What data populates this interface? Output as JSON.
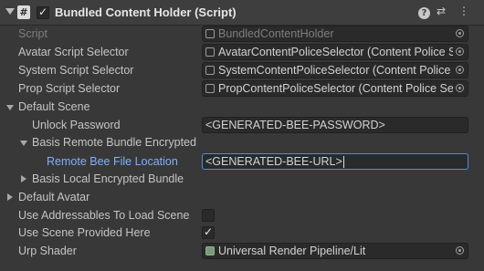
{
  "header": {
    "title": "Bundled Content Holder (Script)",
    "enabled": true,
    "script_icon": "#",
    "help_icon": "?",
    "presets_icon": "⇄",
    "menu_icon": "⋮"
  },
  "fields": {
    "script": {
      "label": "Script",
      "value": "BundledContentHolder"
    },
    "avatar_selector": {
      "label": "Avatar Script Selector",
      "value": "AvatarContentPoliceSelector (Content Police Selector)"
    },
    "system_selector": {
      "label": "System Script Selector",
      "value": "SystemContentPoliceSelector (Content Police Selector)"
    },
    "prop_selector": {
      "label": "Prop Script Selector",
      "value": "PropContentPoliceSelector (Content Police Selector)"
    },
    "default_scene": {
      "label": "Default Scene"
    },
    "unlock_password": {
      "label": "Unlock Password",
      "value": "<GENERATED-BEE-PASSWORD>"
    },
    "remote_bundle": {
      "label": "Basis Remote Bundle Encrypted"
    },
    "remote_bee_file": {
      "label": "Remote Bee File Location",
      "value": "<GENERATED-BEE-URL>"
    },
    "local_bundle": {
      "label": "Basis Local Encrypted Bundle"
    },
    "default_avatar": {
      "label": "Default Avatar"
    },
    "use_addressables": {
      "label": "Use Addressables To Load Scene",
      "checked": false
    },
    "use_scene_provided": {
      "label": "Use Scene Provided Here",
      "checked": true
    },
    "urp_shader": {
      "label": "Urp Shader",
      "value": "Universal Render Pipeline/Lit"
    }
  }
}
